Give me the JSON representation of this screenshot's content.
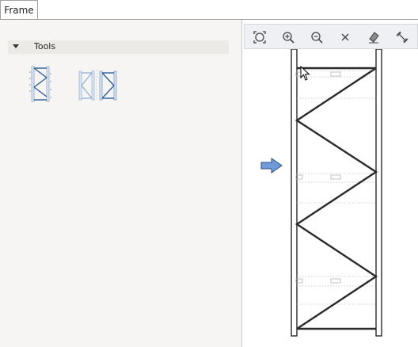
{
  "tabs": [
    {
      "label": "Frame"
    }
  ],
  "tools_section": {
    "title": "Tools"
  },
  "tools": [
    {
      "icon": "single-frame-icon"
    },
    {
      "icon": "double-frame-icon"
    }
  ],
  "toolbar": {
    "buttons": [
      {
        "icon": "zoom-extents-icon"
      },
      {
        "icon": "zoom-in-icon"
      },
      {
        "icon": "zoom-out-icon"
      },
      {
        "icon": "close-icon"
      },
      {
        "icon": "eraser-icon"
      },
      {
        "icon": "measure-icon"
      }
    ]
  },
  "colors": {
    "accent_arrow": "#6f9bd8",
    "frame_blue": "#2e5f99"
  }
}
